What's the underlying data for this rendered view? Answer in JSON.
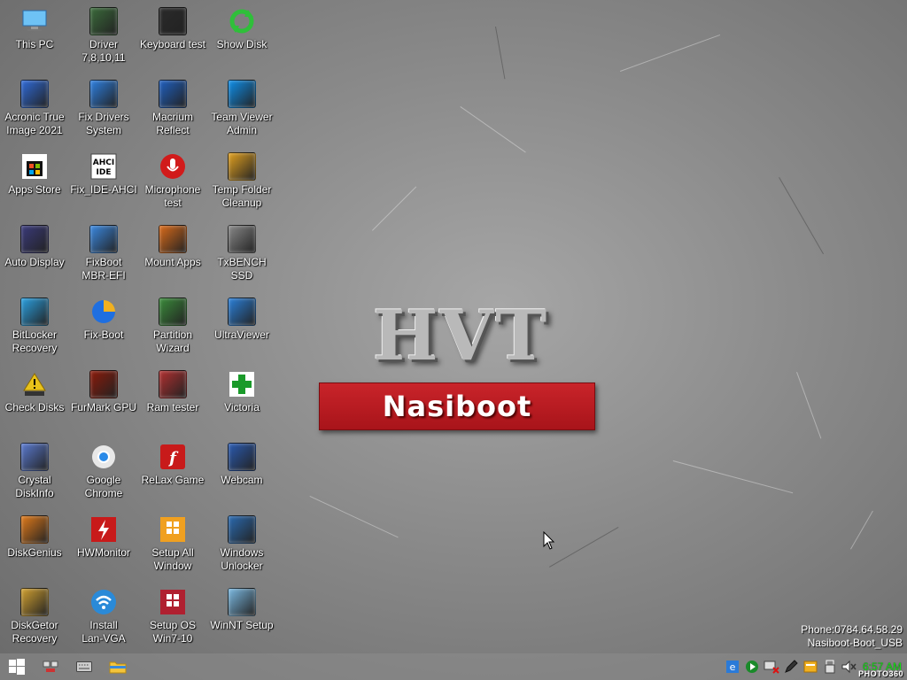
{
  "desktop": {
    "icons": [
      {
        "label": "This PC",
        "icon": "monitor-icon",
        "color": "#4aa3e8"
      },
      {
        "label": "Driver\n7,8,10,11",
        "icon": "driver-cube-icon",
        "color": "#3a6a3a"
      },
      {
        "label": "Keyboard test",
        "icon": "keyboard-test-icon",
        "color": "#2a2a2a"
      },
      {
        "label": "Show Disk",
        "icon": "refresh-arrows-icon",
        "color": "#2fbf3a"
      },
      {
        "label": "Acronic True\nImage 2021",
        "icon": "acronis-icon",
        "color": "#2f6ad8"
      },
      {
        "label": "Fix Drivers\nSystem",
        "icon": "fix-drivers-icon",
        "color": "#2d7fe0"
      },
      {
        "label": "Macrium\nReflect",
        "icon": "macrium-icon",
        "color": "#1f5fbf"
      },
      {
        "label": "Team Viewer\nAdmin",
        "icon": "teamviewer-icon",
        "color": "#0e8ee9"
      },
      {
        "label": "Apps Store",
        "icon": "store-bag-icon",
        "color": "#111111"
      },
      {
        "label": "Fix_IDE-AHCI",
        "icon": "ahci-ide-icon",
        "color": "#ffffff"
      },
      {
        "label": "Microphone\ntest",
        "icon": "microphone-icon",
        "color": "#d11b1b"
      },
      {
        "label": "Temp Folder\nCleanup",
        "icon": "broom-icon",
        "color": "#e0a020"
      },
      {
        "label": "Auto Display",
        "icon": "display-paint-icon",
        "color": "#3a3a7a"
      },
      {
        "label": "FixBoot\nMBR-EFI",
        "icon": "wrench-icon",
        "color": "#3a88e0"
      },
      {
        "label": "Mount Apps",
        "icon": "tools-cross-icon",
        "color": "#d86a1a"
      },
      {
        "label": "TxBENCH SSD",
        "icon": "ssd-icon",
        "color": "#888888"
      },
      {
        "label": "BitLocker\nRecovery",
        "icon": "bitlocker-search-icon",
        "color": "#2aa0e0"
      },
      {
        "label": "Fix-Boot",
        "icon": "pie-chart-icon",
        "color": "#1f6fe0"
      },
      {
        "label": "Partition\nWizard",
        "icon": "partition-wizard-icon",
        "color": "#3a8a3a"
      },
      {
        "label": "UltraViewer",
        "icon": "ultraviewer-icon",
        "color": "#2a7fd8"
      },
      {
        "label": "Check Disks",
        "icon": "warning-drive-icon",
        "color": "#e8c21a"
      },
      {
        "label": "FurMark GPU",
        "icon": "furmark-icon",
        "color": "#8a1a0a"
      },
      {
        "label": "Ram tester",
        "icon": "ram-tester-icon",
        "color": "#b03030"
      },
      {
        "label": "Victoria",
        "icon": "green-cross-icon",
        "color": "#1a9a2a"
      },
      {
        "label": "Crystal\nDiskInfo",
        "icon": "crystal-diskinfo-icon",
        "color": "#5a7ad0"
      },
      {
        "label": "Google\nChrome",
        "icon": "chrome-icon",
        "color": "#2a8ae8"
      },
      {
        "label": "ReLax Game",
        "icon": "flash-icon",
        "color": "#c81a1a"
      },
      {
        "label": "Webcam",
        "icon": "webcam-icon",
        "color": "#2a5ab0"
      },
      {
        "label": "DiskGenius",
        "icon": "diskgenius-icon",
        "color": "#e07a1a"
      },
      {
        "label": "HWMonitor",
        "icon": "hwmonitor-icon",
        "color": "#c81a1a"
      },
      {
        "label": "Setup All\nWindow",
        "icon": "windows10-box-icon",
        "color": "#f0a020"
      },
      {
        "label": "Windows\nUnlocker",
        "icon": "windows-unlocker-icon",
        "color": "#2a6ab0"
      },
      {
        "label": "DiskGetor\nRecovery",
        "icon": "magnifier-disk-icon",
        "color": "#d0a030"
      },
      {
        "label": "Install\nLan-VGA",
        "icon": "wifi-icon",
        "color": "#2a8ad8"
      },
      {
        "label": "Setup OS\nWin7-10",
        "icon": "windows81-box-icon",
        "color": "#c0303a"
      },
      {
        "label": "WinNT Setup",
        "icon": "winnt-setup-icon",
        "color": "#7ab8e0"
      }
    ]
  },
  "logo": {
    "title": "HVT",
    "subtitle": "Nasiboot"
  },
  "info": {
    "phone": "Phone:0784.64.58.29",
    "name": "Nasiboot-Boot_USB"
  },
  "taskbar": {
    "clock": "6:57 AM",
    "watermark": "PHOTO360",
    "start_icon": "windows-start-icon",
    "buttons": [
      "network-share-icon",
      "keyboard-icon",
      "file-explorer-icon"
    ],
    "tray": [
      "ie-icon",
      "media-player-icon",
      "network-disconnected-icon",
      "pen-icon",
      "folder-tray-icon",
      "usb-icon",
      "volume-muted-icon"
    ]
  },
  "colors": {
    "accent_red": "#c9242a",
    "clock_green": "#17e017"
  }
}
